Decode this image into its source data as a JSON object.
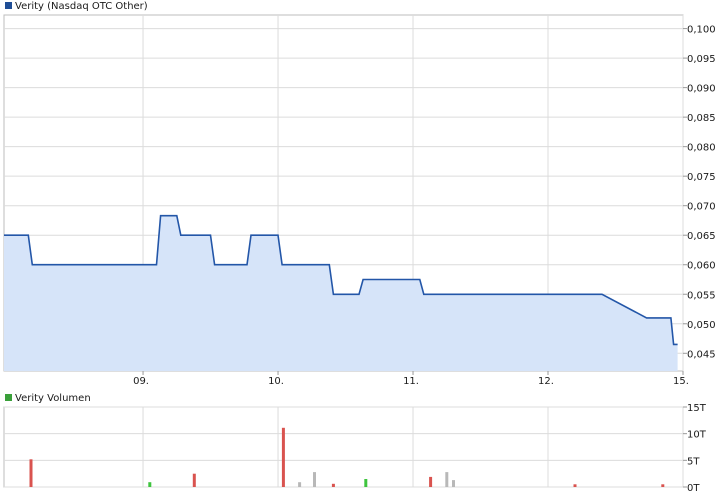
{
  "chart_data": [
    {
      "type": "area",
      "legend": {
        "label": "Verity (Nasdaq OTC Other)",
        "color": "#1f4e96",
        "placement": "top-left"
      },
      "line_color": "#2356a8",
      "fill_color": "#d6e4f9",
      "xlabels": [
        "09.",
        "10.",
        "11.",
        "12.",
        "15."
      ],
      "ytick_labels": [
        "0,100",
        "0,095",
        "0,090",
        "0,085",
        "0,080",
        "0,075",
        "0,070",
        "0,065",
        "0,060",
        "0,055",
        "0,050",
        "0,045"
      ],
      "yticks": [
        0.1,
        0.095,
        0.09,
        0.085,
        0.08,
        0.075,
        0.07,
        0.065,
        0.06,
        0.055,
        0.05,
        0.045
      ],
      "ylim": [
        0.042,
        0.1023
      ],
      "xlim": [
        -0.03,
        5.0
      ],
      "grid": true,
      "x": [
        -0.03,
        0.15,
        0.18,
        0.92,
        0.95,
        0.98,
        1.1,
        1.13,
        1.15,
        1.25,
        1.28,
        1.5,
        1.53,
        1.77,
        1.8,
        1.82,
        2.0,
        2.03,
        2.38,
        2.41,
        2.6,
        2.63,
        2.87,
        2.9,
        2.95,
        3.0,
        3.05,
        3.08,
        3.12,
        3.15,
        3.6,
        3.63,
        3.88,
        3.93,
        4.0,
        4.25,
        4.4,
        4.73,
        4.75,
        4.81,
        4.82,
        4.83,
        4.843,
        4.856,
        4.87,
        4.883,
        4.896,
        4.91,
        4.93,
        4.96
      ],
      "y": [
        0.065,
        0.065,
        0.06,
        0.06,
        0.06,
        0.06,
        0.06,
        0.0683,
        0.0683,
        0.0683,
        0.065,
        0.065,
        0.06,
        0.06,
        0.065,
        0.065,
        0.065,
        0.06,
        0.06,
        0.055,
        0.055,
        0.0575,
        0.0575,
        0.0575,
        0.0575,
        0.0575,
        0.0575,
        0.055,
        0.055,
        0.055,
        0.055,
        0.055,
        0.055,
        0.055,
        0.055,
        0.055,
        0.055,
        0.051,
        0.051,
        0.051,
        0.051,
        0.051,
        0.051,
        0.051,
        0.051,
        0.051,
        0.051,
        0.051,
        0.0465,
        0.0465
      ]
    },
    {
      "type": "bar",
      "legend": {
        "label": "Verity Volumen",
        "color": "#3aa03a",
        "placement": "top-left"
      },
      "xlabels": [
        "09.",
        "10.",
        "11.",
        "12.",
        "15."
      ],
      "ytick_labels": [
        "15T",
        "10T",
        "5T",
        "0T"
      ],
      "yticks": [
        15000,
        10000,
        5000,
        0
      ],
      "ylim": [
        0,
        15000
      ],
      "xlim": [
        -0.03,
        5.0
      ],
      "grid": true,
      "bars": [
        {
          "x": 0.17,
          "value": 5200,
          "color": "#d9534f"
        },
        {
          "x": 1.05,
          "value": 900,
          "color": "#3ec43e"
        },
        {
          "x": 1.38,
          "value": 2500,
          "color": "#d9534f"
        },
        {
          "x": 2.04,
          "value": 11100,
          "color": "#d9534f"
        },
        {
          "x": 2.16,
          "value": 900,
          "color": "#b8b8b8"
        },
        {
          "x": 2.27,
          "value": 2800,
          "color": "#b8b8b8"
        },
        {
          "x": 2.41,
          "value": 600,
          "color": "#d9534f"
        },
        {
          "x": 2.65,
          "value": 1500,
          "color": "#3ec43e"
        },
        {
          "x": 3.13,
          "value": 1900,
          "color": "#d9534f"
        },
        {
          "x": 3.25,
          "value": 2800,
          "color": "#b8b8b8"
        },
        {
          "x": 3.3,
          "value": 1300,
          "color": "#b8b8b8"
        },
        {
          "x": 5.2,
          "value": 500,
          "color": "#d9534f"
        },
        {
          "x": 5.85,
          "value": 500,
          "color": "#d9534f"
        }
      ]
    }
  ]
}
